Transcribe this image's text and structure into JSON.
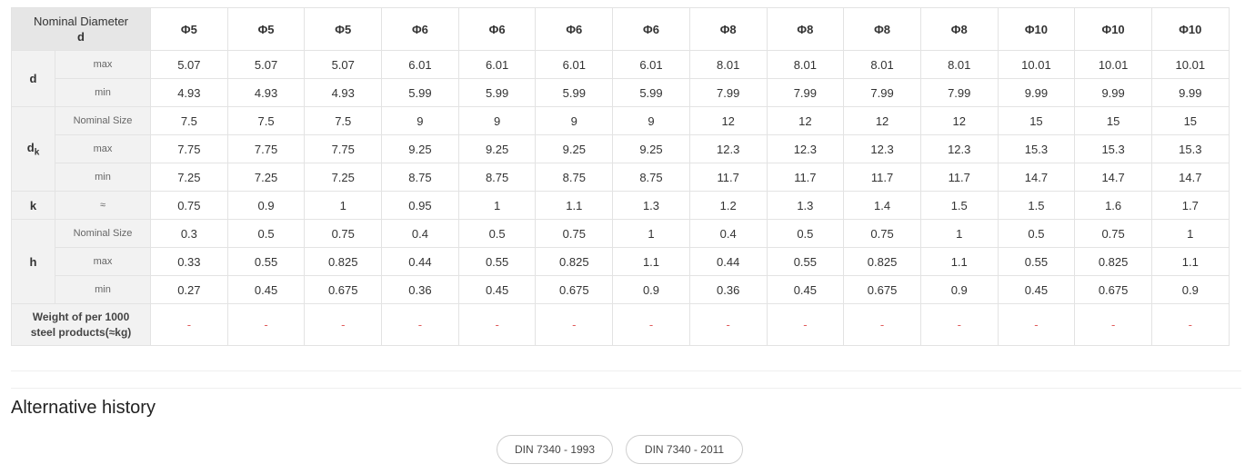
{
  "header": {
    "corner_line1": "Nominal Diameter",
    "corner_line2": "d",
    "sizes": [
      "Φ5",
      "Φ5",
      "Φ5",
      "Φ6",
      "Φ6",
      "Φ6",
      "Φ6",
      "Φ8",
      "Φ8",
      "Φ8",
      "Φ8",
      "Φ10",
      "Φ10",
      "Φ10"
    ]
  },
  "params": {
    "d": "d",
    "dk_main": "d",
    "dk_sub": "k",
    "k": "k",
    "h": "h"
  },
  "rows": [
    {
      "label": "max",
      "values": [
        "5.07",
        "5.07",
        "5.07",
        "6.01",
        "6.01",
        "6.01",
        "6.01",
        "8.01",
        "8.01",
        "8.01",
        "8.01",
        "10.01",
        "10.01",
        "10.01"
      ]
    },
    {
      "label": "min",
      "values": [
        "4.93",
        "4.93",
        "4.93",
        "5.99",
        "5.99",
        "5.99",
        "5.99",
        "7.99",
        "7.99",
        "7.99",
        "7.99",
        "9.99",
        "9.99",
        "9.99"
      ]
    },
    {
      "label": "Nominal Size",
      "values": [
        "7.5",
        "7.5",
        "7.5",
        "9",
        "9",
        "9",
        "9",
        "12",
        "12",
        "12",
        "12",
        "15",
        "15",
        "15"
      ]
    },
    {
      "label": "max",
      "values": [
        "7.75",
        "7.75",
        "7.75",
        "9.25",
        "9.25",
        "9.25",
        "9.25",
        "12.3",
        "12.3",
        "12.3",
        "12.3",
        "15.3",
        "15.3",
        "15.3"
      ]
    },
    {
      "label": "min",
      "values": [
        "7.25",
        "7.25",
        "7.25",
        "8.75",
        "8.75",
        "8.75",
        "8.75",
        "11.7",
        "11.7",
        "11.7",
        "11.7",
        "14.7",
        "14.7",
        "14.7"
      ]
    },
    {
      "label": "≈",
      "values": [
        "0.75",
        "0.9",
        "1",
        "0.95",
        "1",
        "1.1",
        "1.3",
        "1.2",
        "1.3",
        "1.4",
        "1.5",
        "1.5",
        "1.6",
        "1.7"
      ]
    },
    {
      "label": "Nominal Size",
      "values": [
        "0.3",
        "0.5",
        "0.75",
        "0.4",
        "0.5",
        "0.75",
        "1",
        "0.4",
        "0.5",
        "0.75",
        "1",
        "0.5",
        "0.75",
        "1"
      ]
    },
    {
      "label": "max",
      "values": [
        "0.33",
        "0.55",
        "0.825",
        "0.44",
        "0.55",
        "0.825",
        "1.1",
        "0.44",
        "0.55",
        "0.825",
        "1.1",
        "0.55",
        "0.825",
        "1.1"
      ]
    },
    {
      "label": "min",
      "values": [
        "0.27",
        "0.45",
        "0.675",
        "0.36",
        "0.45",
        "0.675",
        "0.9",
        "0.36",
        "0.45",
        "0.675",
        "0.9",
        "0.45",
        "0.675",
        "0.9"
      ]
    }
  ],
  "weight": {
    "label_line1": "Weight of per 1000",
    "label_line2": "steel products(≈kg)",
    "values": [
      "-",
      "-",
      "-",
      "-",
      "-",
      "-",
      "-",
      "-",
      "-",
      "-",
      "-",
      "-",
      "-",
      "-"
    ]
  },
  "alternative": {
    "title": "Alternative history",
    "buttons": [
      "DIN 7340 - 1993",
      "DIN 7340 - 2011"
    ]
  }
}
